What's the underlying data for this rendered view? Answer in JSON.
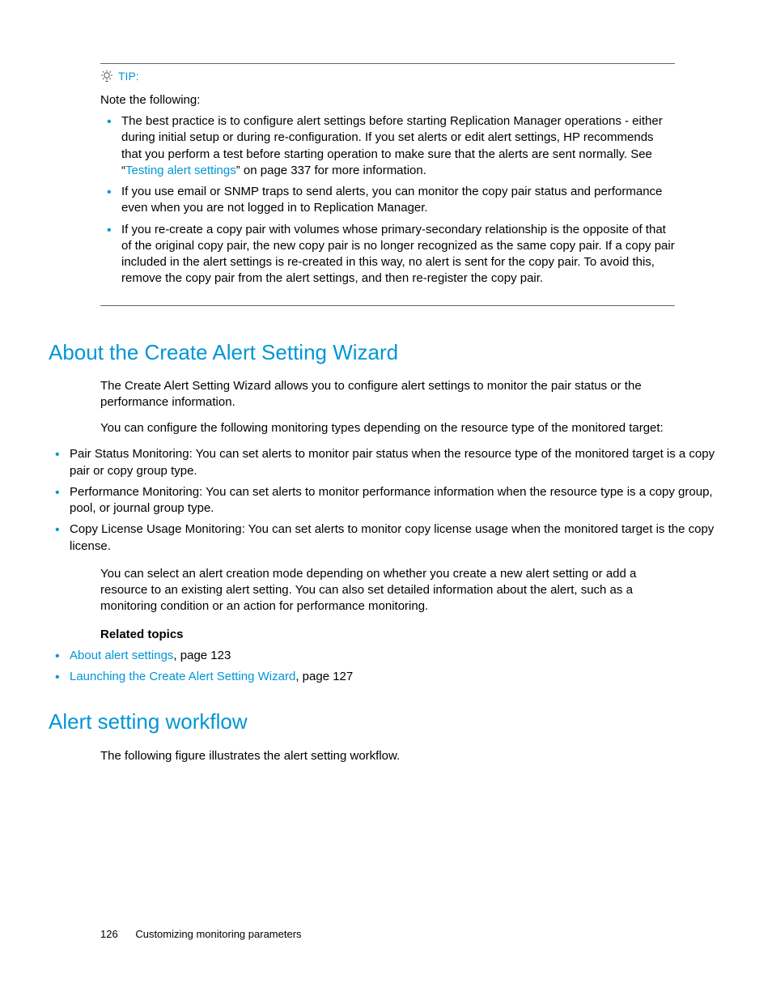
{
  "tip": {
    "label": "TIP:",
    "note": "Note the following:",
    "items": [
      {
        "pre": "The best practice is to configure alert settings before starting Replication Manager operations - either during initial setup or during re-configuration. If you set alerts or edit alert settings, HP recommends that you perform a test before starting operation to make sure that the alerts are sent normally. See “",
        "link": "Testing alert settings",
        "post": "” on page 337 for more information."
      },
      {
        "text": "If you use email or SNMP traps to send alerts, you can monitor the copy pair status and performance even when you are not logged in to Replication Manager."
      },
      {
        "text": "If you re-create a copy pair with volumes whose primary-secondary relationship is the opposite of that of the original copy pair, the new copy pair is no longer recognized as the same copy pair. If a copy pair included in the alert settings is re-created in this way, no alert is sent for the copy pair. To avoid this, remove the copy pair from the alert settings, and then re-register the copy pair."
      }
    ]
  },
  "section1": {
    "title": "About the Create Alert Setting Wizard",
    "p1": "The Create Alert Setting Wizard allows you to configure alert settings to monitor the pair status or the performance information.",
    "p2": "You can configure the following monitoring types depending on the resource type of the monitored target:",
    "bullets": [
      "Pair Status Monitoring: You can set alerts to monitor pair status when the resource type of the monitored target is a copy pair or copy group type.",
      "Performance Monitoring: You can set alerts to monitor performance information when the resource type is a copy group, pool, or journal group type.",
      "Copy License Usage Monitoring: You can set alerts to monitor copy license usage when the monitored target is the copy license."
    ],
    "p3": "You can select an alert creation mode depending on whether you create a new alert setting or add a resource to an existing alert setting. You can also set detailed information about the alert, such as a monitoring condition or an action for performance monitoring.",
    "related_heading": "Related topics",
    "related": [
      {
        "link": "About alert settings",
        "suffix": ", page 123"
      },
      {
        "link": "Launching the Create Alert Setting Wizard",
        "suffix": ", page 127"
      }
    ]
  },
  "section2": {
    "title": "Alert setting workflow",
    "p1": "The following figure illustrates the alert setting workflow."
  },
  "footer": {
    "page": "126",
    "chapter": "Customizing monitoring parameters"
  }
}
